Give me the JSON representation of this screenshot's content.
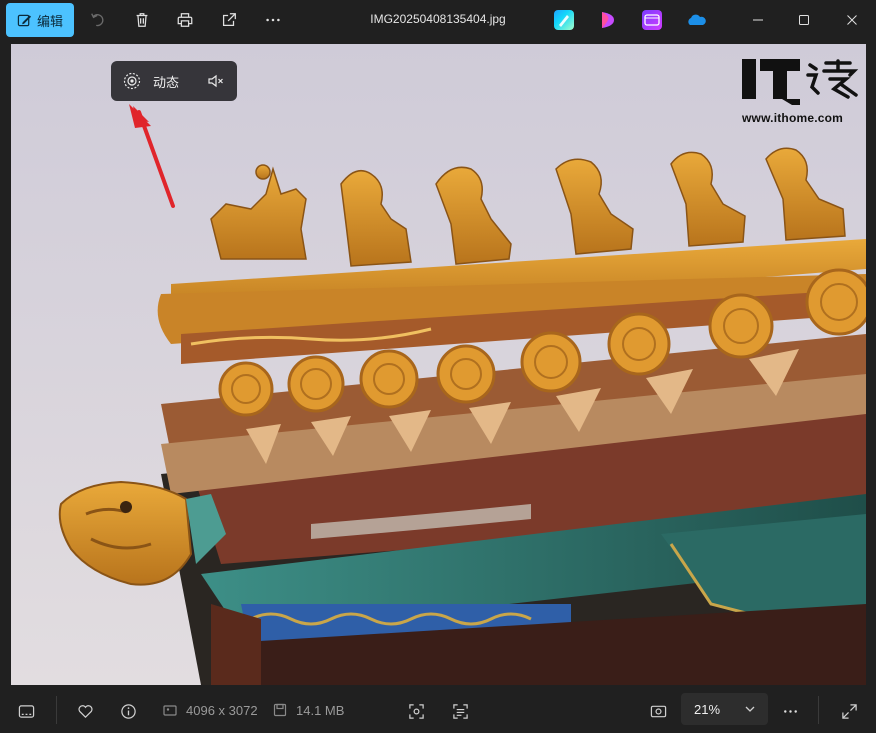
{
  "titlebar": {
    "edit_label": "编辑",
    "file_name": "IMG20250408135404.jpg",
    "icons": [
      "edit-icon",
      "rotate-icon",
      "delete-icon",
      "print-icon",
      "share-icon",
      "more-icon"
    ],
    "apps": [
      "designer-icon",
      "clipchamp-icon",
      "video-editor-icon",
      "onedrive-icon"
    ],
    "window_controls": [
      "minimize-icon",
      "maximize-icon",
      "close-icon"
    ]
  },
  "motion": {
    "label": "动态"
  },
  "watermark": {
    "url": "www.ithome.com"
  },
  "bottombar": {
    "dimensions": "4096 x 3072",
    "file_size": "14.1 MB",
    "zoom": "21%"
  },
  "colors": {
    "accent": "#4cc2ff",
    "background": "#202020",
    "arrow": "#e0252b"
  }
}
